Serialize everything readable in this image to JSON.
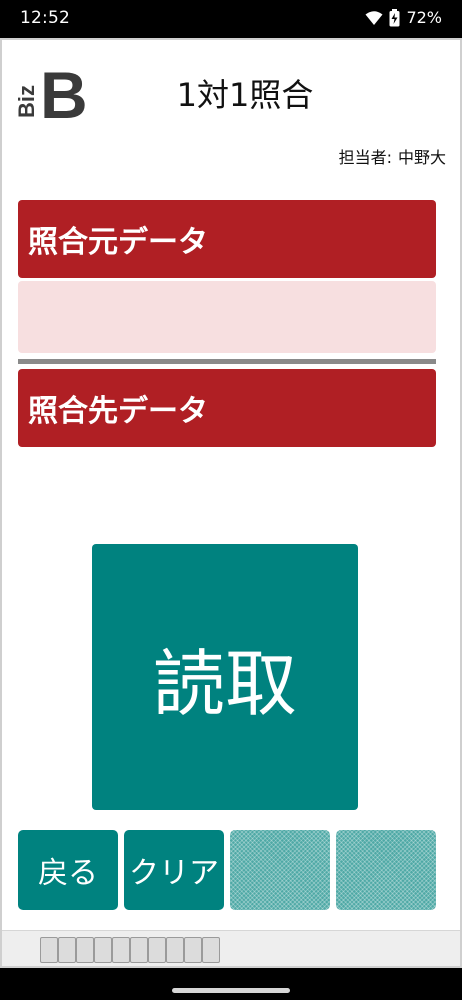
{
  "status_bar": {
    "time": "12:52",
    "battery_percent": "72%",
    "icons": [
      "wifi-icon",
      "battery-charging-icon"
    ]
  },
  "header": {
    "logo_text": "BizB",
    "title": "1対1照合",
    "operator_label": "担当者:",
    "operator_name": "中野大"
  },
  "sections": {
    "source_label": "照合元データ",
    "source_value": "",
    "target_label": "照合先データ",
    "target_value": ""
  },
  "scan_button": {
    "label": "読取"
  },
  "bottom_buttons": {
    "back": "戻る",
    "clear": "クリア",
    "blank1": "",
    "blank2": ""
  },
  "colors": {
    "section_header": "#b01f24",
    "source_content_bg": "#f7dfe0",
    "primary_button": "#00827f",
    "divider": "#8a8a8a"
  },
  "tray": {
    "slot_count": 10
  }
}
